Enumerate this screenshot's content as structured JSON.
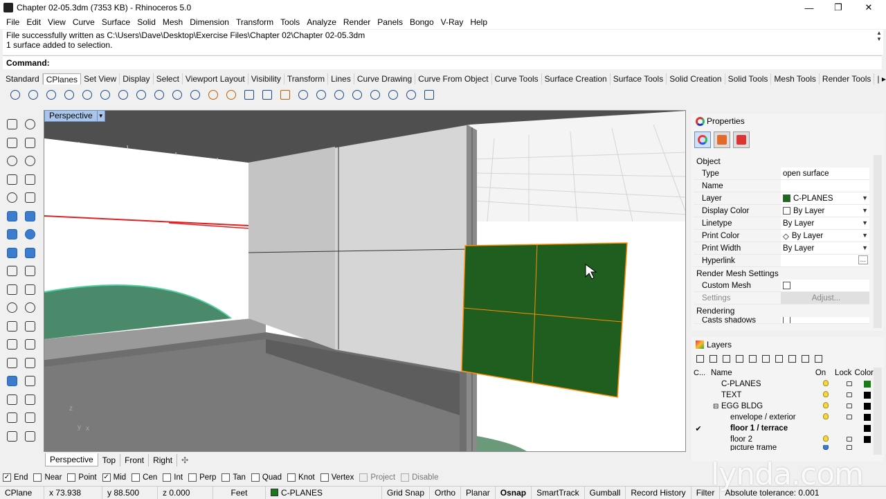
{
  "window": {
    "title": "Chapter 02-05.3dm (7353 KB) - Rhinoceros 5.0",
    "minimize": "—",
    "maximize": "❐",
    "close": "✕"
  },
  "menu": [
    "File",
    "Edit",
    "View",
    "Curve",
    "Surface",
    "Solid",
    "Mesh",
    "Dimension",
    "Transform",
    "Tools",
    "Analyze",
    "Render",
    "Panels",
    "Bongo",
    "V-Ray",
    "Help"
  ],
  "history": {
    "line1": "File successfully written as C:\\Users\\Dave\\Desktop\\Exercise Files\\Chapter 02\\Chapter 02-05.3dm",
    "line2": "1 surface added to selection."
  },
  "command": {
    "label": "Command:"
  },
  "toolbar_tabs": [
    "Standard",
    "CPlanes",
    "Set View",
    "Display",
    "Select",
    "Viewport Layout",
    "Visibility",
    "Transform",
    "Lines",
    "Curve Drawing",
    "Curve From Object",
    "Curve Tools",
    "Surface Creation",
    "Surface Tools",
    "Solid Creation",
    "Solid Tools",
    "Mesh Tools",
    "Render Tools",
    "| ▸"
  ],
  "active_toolbar_tab": "CPlanes",
  "viewport": {
    "title": "Perspective",
    "dropdown": "▼",
    "tabs": [
      "Perspective",
      "Top",
      "Front",
      "Right",
      "✣"
    ],
    "axis_z": "z",
    "axis_y": "y",
    "axis_x": "x"
  },
  "properties": {
    "title": "Properties",
    "section_object": "Object",
    "rows": [
      {
        "key": "Type",
        "value": "open surface"
      },
      {
        "key": "Name",
        "value": ""
      },
      {
        "key": "Layer",
        "value": "C-PLANES"
      },
      {
        "key": "Display Color",
        "value": "By Layer"
      },
      {
        "key": "Linetype",
        "value": "By Layer"
      },
      {
        "key": "Print Color",
        "value": "By Layer"
      },
      {
        "key": "Print Width",
        "value": "By Layer"
      },
      {
        "key": "Hyperlink",
        "value": "..."
      }
    ],
    "section_mesh": "Render Mesh Settings",
    "custom_mesh": "Custom Mesh",
    "settings": "Settings",
    "adjust": "Adjust...",
    "section_rendering": "Rendering",
    "cast_shadows": "Casts shadows",
    "layer_color": "#1a6b1a"
  },
  "layers": {
    "title": "Layers",
    "headers": {
      "c": "C...",
      "name": "Name",
      "on": "On",
      "lock": "Lock",
      "color": "Color"
    },
    "rows": [
      {
        "name": "C-PLANES",
        "current": false,
        "bold": false,
        "indent": 0,
        "color": "#1a7a1a"
      },
      {
        "name": "TEXT",
        "current": false,
        "bold": false,
        "indent": 0,
        "color": "#000000"
      },
      {
        "name": "EGG BLDG",
        "current": false,
        "bold": false,
        "indent": 0,
        "color": "#000000",
        "expander": "⊟"
      },
      {
        "name": "envelope / exterior",
        "current": false,
        "bold": false,
        "indent": 1,
        "color": "#000000"
      },
      {
        "name": "floor 1 / terrace",
        "current": true,
        "bold": true,
        "indent": 1,
        "color": "#000000"
      },
      {
        "name": "floor 2",
        "current": false,
        "bold": false,
        "indent": 1,
        "color": "#000000"
      },
      {
        "name": "picture frame",
        "current": false,
        "bold": false,
        "indent": 1,
        "color": "#000000"
      }
    ],
    "check": "✔"
  },
  "osnap": [
    {
      "label": "End",
      "checked": true
    },
    {
      "label": "Near",
      "checked": false
    },
    {
      "label": "Point",
      "checked": false
    },
    {
      "label": "Mid",
      "checked": true
    },
    {
      "label": "Cen",
      "checked": false
    },
    {
      "label": "Int",
      "checked": false
    },
    {
      "label": "Perp",
      "checked": false
    },
    {
      "label": "Tan",
      "checked": false
    },
    {
      "label": "Quad",
      "checked": false
    },
    {
      "label": "Knot",
      "checked": false
    },
    {
      "label": "Vertex",
      "checked": false
    },
    {
      "label": "Project",
      "checked": false,
      "disabled": true
    },
    {
      "label": "Disable",
      "checked": false,
      "disabled": true
    }
  ],
  "status": {
    "cplane": "CPlane",
    "x": "x 73.938",
    "y": "y 88.500",
    "z": "z 0.000",
    "units": "Feet",
    "layer": "C-PLANES",
    "grid_snap": "Grid Snap",
    "ortho": "Ortho",
    "planar": "Planar",
    "osnap": "Osnap",
    "smarttrack": "SmartTrack",
    "gumball": "Gumball",
    "record_history": "Record History",
    "filter": "Filter",
    "tolerance": "Absolute tolerance: 0.001"
  },
  "watermark": "lynda.com"
}
